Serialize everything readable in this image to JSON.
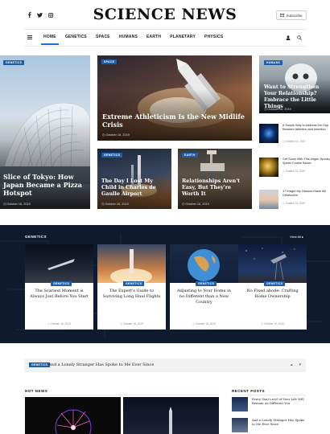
{
  "header": {
    "logo": "SCIENCE NEWS",
    "subscribe_label": "Subscribe",
    "social": [
      "facebook-icon",
      "twitter-icon",
      "instagram-icon"
    ]
  },
  "nav": {
    "items": [
      "HOME",
      "GENETICS",
      "SPACE",
      "HUMANS",
      "EARTH",
      "PLANETARY",
      "PHYSICS"
    ],
    "active": "HOME"
  },
  "featured": [
    {
      "tag": "GENETICS",
      "title": "Slice of Tokyo: How Japan Became a Pizza Hotspot",
      "date": "October 16, 2019"
    },
    {
      "tag": "SPACE",
      "title": "Extreme Athleticism Is the New Midlife Crisis",
      "date": "October 16, 2019"
    },
    {
      "tag": "GENETICS",
      "title": "The Day I Lost My Child in Charles de Gaulle Airport",
      "date": "October 16, 2019"
    },
    {
      "tag": "EARTH",
      "title": "Relationships Aren't Easy, But They're Worth It",
      "date": "October 16, 2019"
    },
    {
      "tag": "HUMANS",
      "title": "Want to Strengthen Your Relationship? Embrace the Little Things",
      "date": "October 16, 2019"
    }
  ],
  "side_list": [
    {
      "title": "A Simple Way to Address the Gap Between Attention and Intention",
      "date": "October 16, 2019"
    },
    {
      "title": "Get Scary With This Vegan Spooky Spider Cookie Sauce",
      "date": "October 16, 2019"
    },
    {
      "title": "17 Insight My Glasses Made Me Destructive",
      "date": "October 16, 2019"
    }
  ],
  "genetics_section": {
    "title": "GENETICS",
    "view_all": "View All ▸",
    "cards": [
      {
        "tag": "GENETICS",
        "title": "The Scariest Moment is Always Just Before You Start",
        "date": "October 16, 2019"
      },
      {
        "tag": "GENETICS",
        "title": "The Expert's Guide to Surviving Long Haul Flights",
        "date": "October 16, 2019"
      },
      {
        "tag": "GENETICS",
        "title": "Adjusting to Your Home in no Different than a New Country",
        "date": "October 16, 2019"
      },
      {
        "tag": "GENETICS",
        "title": "No Fixed abode: Crafting Home Ownership",
        "date": "October 16, 2019"
      }
    ]
  },
  "ticker": {
    "tag": "GENETICS",
    "text": "And a Lonely Stranger Has Spoke to Me Ever Since"
  },
  "hot_news": {
    "title": "HOT NEWS"
  },
  "recent_posts": {
    "title": "RECENT POSTS",
    "items": [
      {
        "title": "Every Seat Level of Your Life Will Remain As Different You"
      },
      {
        "title": "And a Lonely Stranger Has Spoke to Me Ever Since"
      }
    ]
  }
}
